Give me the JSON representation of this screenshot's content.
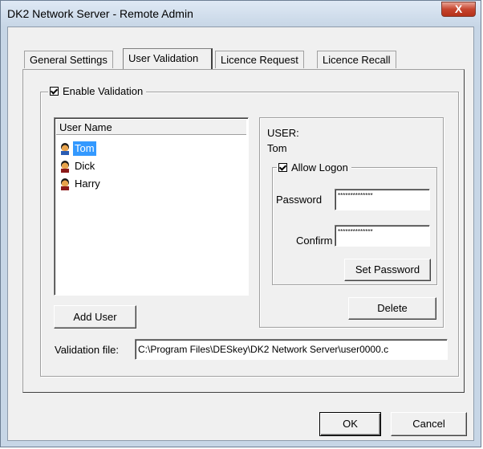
{
  "window": {
    "title": "DK2 Network Server - Remote Admin",
    "close_label": "X"
  },
  "tabs": [
    {
      "label": "General Settings"
    },
    {
      "label": "User Validation"
    },
    {
      "label": "Licence Request"
    },
    {
      "label": "Licence Recall"
    }
  ],
  "validation": {
    "enable_label": "Enable Validation",
    "user_list": {
      "header": "User Name",
      "users": [
        "Tom",
        "Dick",
        "Harry"
      ],
      "selected": "Tom"
    },
    "add_user_label": "Add User",
    "file_label": "Validation file:",
    "file_value": "C:\\Program Files\\DESkey\\DK2 Network Server\\user0000.c"
  },
  "user_panel": {
    "heading": "USER:",
    "name": "Tom",
    "allow_logon_label": "Allow Logon",
    "password_label": "Password",
    "password_value": "**************",
    "confirm_label": "Confirm",
    "confirm_value": "**************",
    "set_password_label": "Set Password",
    "delete_label": "Delete"
  },
  "footer": {
    "ok_label": "OK",
    "cancel_label": "Cancel"
  }
}
